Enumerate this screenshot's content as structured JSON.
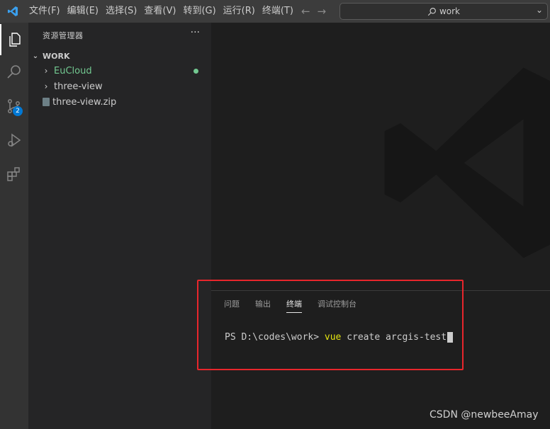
{
  "titlebar": {
    "menu": [
      "文件(F)",
      "编辑(E)",
      "选择(S)",
      "查看(V)",
      "转到(G)",
      "运行(R)",
      "终端(T)"
    ],
    "back_icon": "arrow-left-icon",
    "forward_icon": "arrow-right-icon",
    "search_text": "work"
  },
  "activitybar": {
    "items": [
      "explorer-icon",
      "search-icon",
      "source-control-icon",
      "run-debug-icon",
      "extensions-icon"
    ],
    "scm_badge": "2"
  },
  "sidebar": {
    "title": "资源管理器",
    "more": "···",
    "workspace": "WORK",
    "items": [
      {
        "label": "EuCloud",
        "type": "folder"
      },
      {
        "label": "three-view",
        "type": "folder"
      },
      {
        "label": "three-view.zip",
        "type": "file"
      }
    ]
  },
  "panel": {
    "tabs": [
      "问题",
      "输出",
      "终端",
      "调试控制台"
    ],
    "active_tab": "终端",
    "prompt": "PS D:\\codes\\work> ",
    "command_keyword": "vue",
    "command_rest": " create arcgis-test"
  },
  "credit": "CSDN @newbeeAmay",
  "colors": {
    "accent": "#0078d4",
    "highlight_border": "#e8262c",
    "git_modified": "#73c991"
  }
}
